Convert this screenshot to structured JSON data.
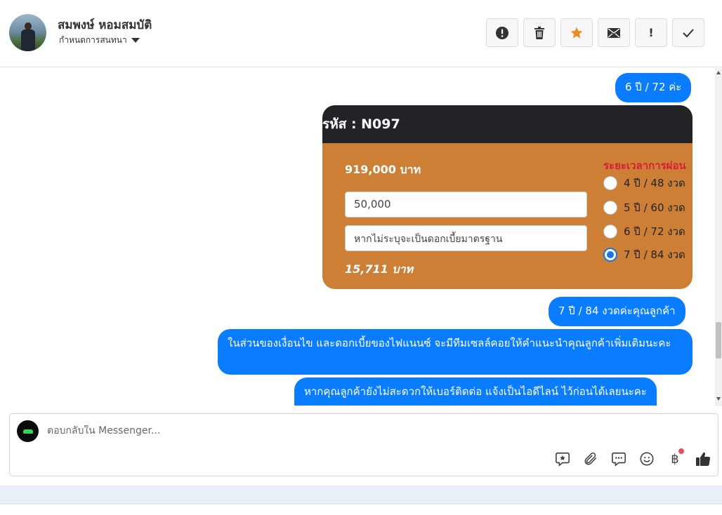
{
  "header": {
    "user_name": "สมพงษ์ หอมสมบัติ",
    "conversation_settings": "กำหนดการสนทนา",
    "toolbar": [
      {
        "name": "spam-button",
        "icon": "alert-circle-icon"
      },
      {
        "name": "delete-button",
        "icon": "trash-icon"
      },
      {
        "name": "star-button",
        "icon": "star-icon",
        "color": "#f08a24"
      },
      {
        "name": "mark-unread-button",
        "icon": "envelope-icon"
      },
      {
        "name": "follow-up-button",
        "label": "!"
      },
      {
        "name": "done-button",
        "icon": "check-icon"
      }
    ]
  },
  "messages": [
    {
      "text": "6 ปี / 72 ค่ะ"
    },
    {
      "text": "7 ปี / 84 งวดค่ะคุณลูกค้า"
    },
    {
      "text": "ในส่วนของเงื่อนไข และดอกเบี้ยของไฟแนนซ์ จะมีทีมเซลล์คอยให้คำแนะนำคุณลูกค้าเพิ่มเติมนะคะ"
    },
    {
      "text": "หากคุณลูกค้ายังไม่สะดวกให้เบอร์ติดต่อ แจ้งเป็นไอดีไลน์ ไว้ก่อนได้เลยนะคะ"
    }
  ],
  "calculator": {
    "code": "รหัส : N097",
    "price": "919,000 บาท",
    "down_payment_value": "50,000",
    "interest_placeholder": "หากไม่ระบุจะเป็นดอกเบี้ยมาตรฐาน",
    "monthly": "15,711 บาท",
    "period_title": "ระยะเวลาการผ่อน",
    "options": [
      {
        "label": "4 ปี / 48 งวด",
        "checked": false
      },
      {
        "label": "5 ปี / 60 งวด",
        "checked": false
      },
      {
        "label": "6 ปี / 72 งวด",
        "checked": false
      },
      {
        "label": "7 ปี / 84 งวด",
        "checked": true
      }
    ],
    "colors": {
      "card": "#cd7f36",
      "top": "#222326",
      "title": "#d81e3a"
    }
  },
  "composer": {
    "placeholder": "ตอบกลับใน Messenger..."
  },
  "colors": {
    "bubble": "#0a7cff"
  }
}
